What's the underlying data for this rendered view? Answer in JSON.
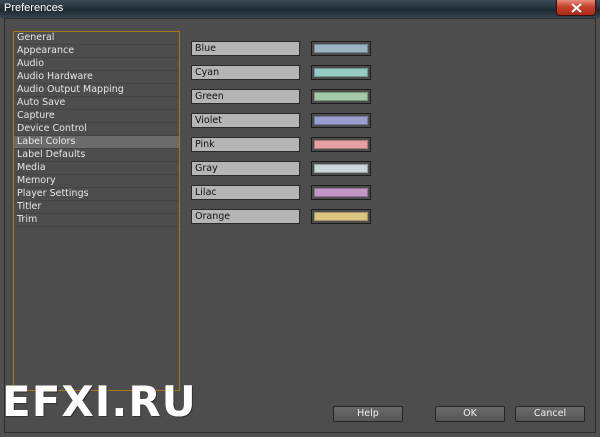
{
  "window": {
    "title": "Preferences"
  },
  "categories": [
    {
      "label": "General"
    },
    {
      "label": "Appearance"
    },
    {
      "label": "Audio"
    },
    {
      "label": "Audio Hardware"
    },
    {
      "label": "Audio Output Mapping"
    },
    {
      "label": "Auto Save"
    },
    {
      "label": "Capture"
    },
    {
      "label": "Device Control"
    },
    {
      "label": "Label Colors",
      "selected": true
    },
    {
      "label": "Label Defaults"
    },
    {
      "label": "Media"
    },
    {
      "label": "Memory"
    },
    {
      "label": "Player Settings"
    },
    {
      "label": "Titler"
    },
    {
      "label": "Trim"
    }
  ],
  "label_colors": [
    {
      "name": "Blue",
      "color": "#9ab4c4"
    },
    {
      "name": "Cyan",
      "color": "#96cbc4"
    },
    {
      "name": "Green",
      "color": "#a4c9a6"
    },
    {
      "name": "Violet",
      "color": "#9b9fd0"
    },
    {
      "name": "Pink",
      "color": "#e6a0a2"
    },
    {
      "name": "Gray",
      "color": "#c9d6d6"
    },
    {
      "name": "Lilac",
      "color": "#c497c7"
    },
    {
      "name": "Orange",
      "color": "#dcc483"
    }
  ],
  "buttons": {
    "help": "Help",
    "ok": "OK",
    "cancel": "Cancel"
  },
  "watermark": "EFXI.RU",
  "icons": {
    "close": "close-icon"
  }
}
